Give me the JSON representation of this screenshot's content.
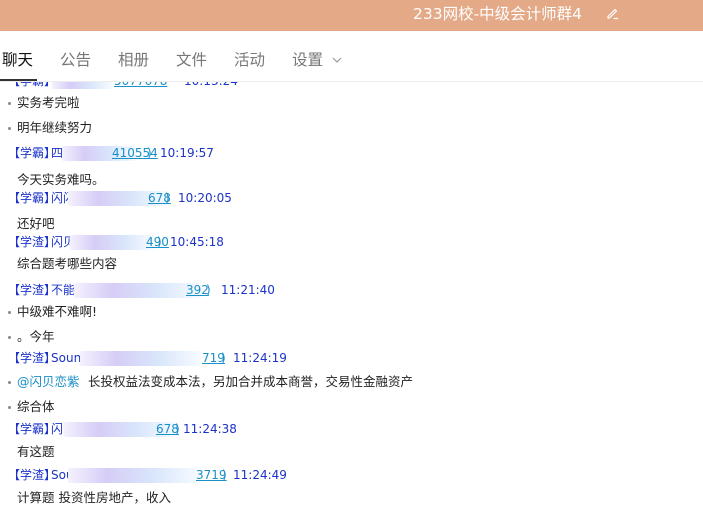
{
  "window": {
    "title": "233网校-中级会计师群4",
    "edit_icon": "edit-pencil-icon"
  },
  "tabs": [
    {
      "label": "聊天"
    },
    {
      "label": "公告"
    },
    {
      "label": "相册"
    },
    {
      "label": "文件"
    },
    {
      "label": "活动"
    },
    {
      "label": "设置"
    }
  ],
  "settings_icon": "chevron-down-icon",
  "chat": {
    "cutoff_header": {
      "role": "【学霸】",
      "qq_tail": "5077678",
      "time": "10:13:24"
    },
    "items": [
      {
        "text": "实务考完啦"
      },
      {
        "text": "明年继续努力"
      },
      {
        "role": "【学霸】",
        "nick": "四川",
        "qq_tail": "410554",
        "paren_close": ")",
        "time": "10:19:57"
      },
      {
        "text": "今天实务难吗。"
      },
      {
        "role": "【学霸】",
        "nick": "闪闪",
        "qq_tail": "678",
        "paren_close": ")",
        "time": "10:20:05"
      },
      {
        "text": "还好吧"
      },
      {
        "role": "【学渣】",
        "nick": "闪贝",
        "qq_tail": "490",
        "paren_close": ")",
        "time": "10:45:18"
      },
      {
        "text": "综合题考哪些内容"
      },
      {
        "role": "【学渣】",
        "nick": "不能",
        "qq_tail": "392",
        "paren_close": ")",
        "time": "11:21:40"
      },
      {
        "text": "中级难不难啊!"
      },
      {
        "text": "。今年"
      },
      {
        "role": "【学渣】",
        "nick": "Soun",
        "qq_tail": "719",
        "paren_close": ")",
        "time": "11:24:19"
      },
      {
        "mention": "@闪贝恋紫",
        "text": "长投权益法变成本法，另加合并成本商誉，交易性金融资产"
      },
      {
        "text": "综合体"
      },
      {
        "role": "【学霸】",
        "nick": "闪闪",
        "qq_tail": "678",
        "paren_close": ")",
        "time": "11:24:38"
      },
      {
        "text": "有这题"
      },
      {
        "role": "【学渣】",
        "nick": "Sou",
        "qq_tail": "3719",
        "paren_close": ")",
        "time": "11:24:49"
      },
      {
        "text": "计算题 投资性房地产，收入"
      }
    ]
  }
}
